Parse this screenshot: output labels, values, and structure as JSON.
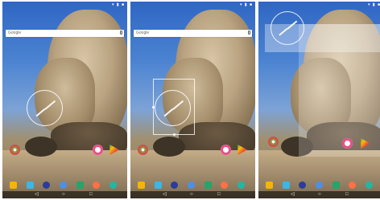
{
  "screens": [
    {
      "search_label": "Google"
    },
    {
      "search_label": "Google"
    },
    {
      "search_label": ""
    }
  ],
  "status_icons": "▾ ▮ ■",
  "nav": {
    "back": "◁",
    "home": "○",
    "recents": "□"
  }
}
